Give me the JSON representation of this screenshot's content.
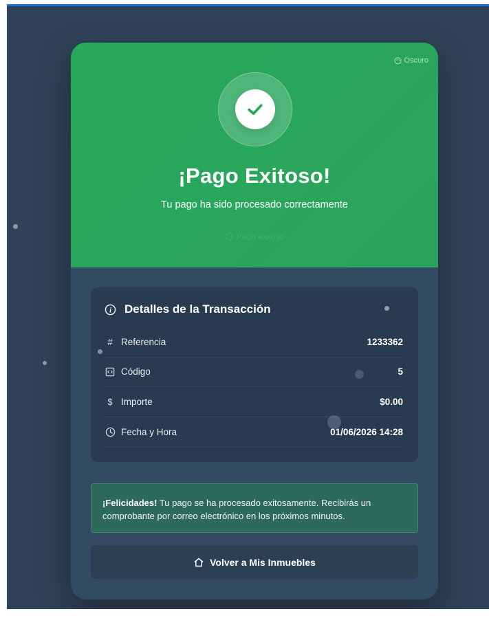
{
  "theme_toggle": {
    "label": "Oscuro",
    "icon": "palette-icon"
  },
  "header": {
    "title": "¡Pago Exitoso!",
    "subtitle": "Tu pago ha sido procesado correctamente",
    "faded_status": "Pago exitoso",
    "accent_color": "#27a85a"
  },
  "details": {
    "title": "Detalles de la Transacción",
    "rows": [
      {
        "icon": "hash-icon",
        "label": "Referencia",
        "value": "1233362"
      },
      {
        "icon": "code-icon",
        "label": "Código",
        "value": "5"
      },
      {
        "icon": "dollar-icon",
        "label": "Importe",
        "value": "$0.00"
      },
      {
        "icon": "clock-icon",
        "label": "Fecha y Hora",
        "value": "01/06/2026 14:28"
      }
    ]
  },
  "notice": {
    "strong": "¡Felicidades!",
    "text": " Tu pago se ha procesado exitosamente. Recibirás un comprobante por correo electrónico en los próximos minutos."
  },
  "back_button": {
    "label": "Volver a Mis Inmuebles",
    "icon": "home-icon"
  }
}
